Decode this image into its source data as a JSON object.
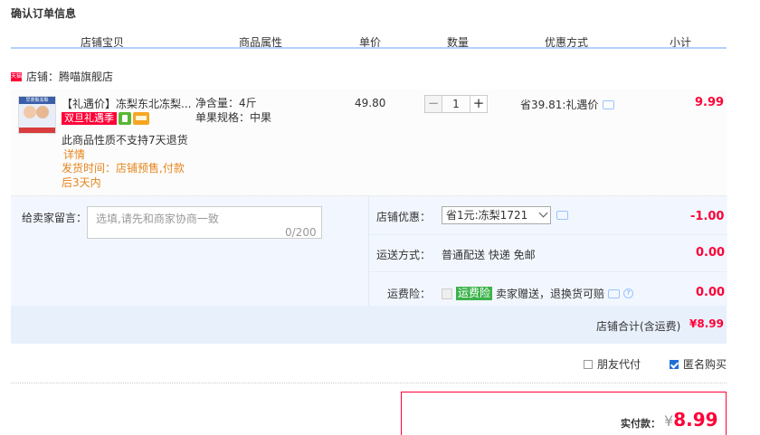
{
  "page_title": "确认订单信息",
  "columns": [
    "店铺宝贝",
    "商品属性",
    "单价",
    "数量",
    "优惠方式",
    "小计"
  ],
  "shop": {
    "label": "店铺：腾喵旗舰店"
  },
  "item": {
    "name": "【礼遇价】冻梨东北冻梨...",
    "tag_red": "双旦礼遇季",
    "no_return": "此商品性质不支持7天退货",
    "detail": "详情",
    "ship_time": "发货时间：店铺预售,付款后3天内",
    "attr_weight": "净含量：4斤",
    "attr_spec": "单果规格：中果",
    "price": "49.80",
    "qty": "1",
    "qty_minus": "−",
    "qty_plus": "+",
    "discount": "省39.81:礼遇价",
    "subtotal": "9.99"
  },
  "message": {
    "label": "给卖家留言：",
    "placeholder": "选填,请先和商家协商一致",
    "counter": "0/200"
  },
  "shop_discount": {
    "label": "店铺优惠：",
    "selected": "省1元:冻梨1721",
    "amount": "-1.00"
  },
  "delivery": {
    "label": "运送方式：",
    "value": "普通配送 快递 免邮",
    "amount": "0.00"
  },
  "insurance": {
    "label": "运费险：",
    "tag": "运费险",
    "text": "卖家赠送，退换货可赔",
    "amount": "0.00"
  },
  "shop_total": {
    "label": "店铺合计(含运费)",
    "amount": "¥8.99"
  },
  "options": {
    "friend_pay": "朋友代付",
    "anonymous": "匿名购买"
  },
  "pay": {
    "label": "实付款：",
    "currency": "¥",
    "amount": "8.99"
  },
  "colors": {
    "accent_red": "#ff0036",
    "header_line": "#b2d1ff",
    "panel_bg": "#f2f7ff"
  }
}
